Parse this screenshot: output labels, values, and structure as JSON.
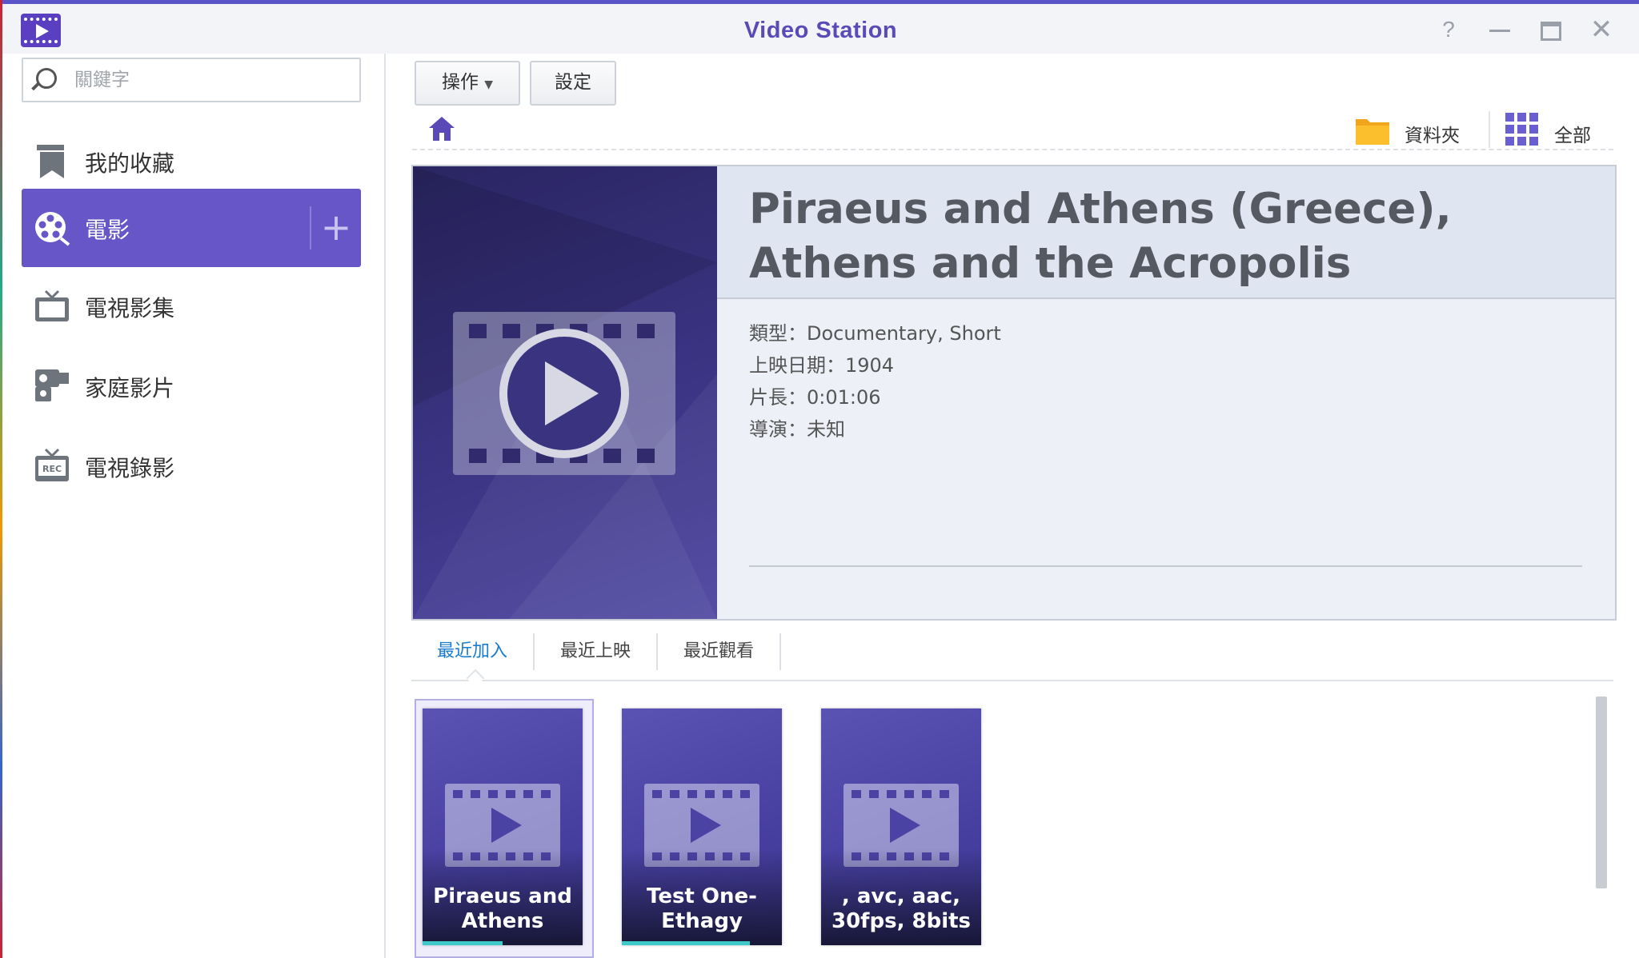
{
  "window": {
    "title": "Video Station",
    "controls": {
      "help": "?",
      "minimize": "minimize",
      "maximize": "maximize",
      "close": "✕"
    }
  },
  "sidebar": {
    "search": {
      "placeholder": "關鍵字",
      "value": ""
    },
    "items": [
      {
        "label": "我的收藏",
        "icon": "bookmark-icon",
        "active": false
      },
      {
        "label": "電影",
        "icon": "film-reel-icon",
        "active": true
      },
      {
        "label": "電視影集",
        "icon": "tv-icon",
        "active": false
      },
      {
        "label": "家庭影片",
        "icon": "camcorder-icon",
        "active": false
      },
      {
        "label": "電視錄影",
        "icon": "tv-rec-icon",
        "active": false
      }
    ],
    "add_label": "+",
    "accent_color": "#6656c7"
  },
  "toolbar": {
    "action_label": "操作",
    "settings_label": "設定",
    "folder_label": "資料夾",
    "all_label": "全部"
  },
  "hero": {
    "title": "Piraeus and Athens (Greece), Athens and the Acropolis",
    "meta": {
      "genre": "類型：Documentary, Short",
      "release": "上映日期：1904",
      "duration": "片長：0:01:06",
      "director": "導演：未知"
    }
  },
  "tabs": [
    {
      "label": "最近加入",
      "active": true
    },
    {
      "label": "最近上映",
      "active": false
    },
    {
      "label": "最近觀看",
      "active": false
    }
  ],
  "cards": [
    {
      "title": "Piraeus and Athens",
      "progress": 0.5,
      "selected": true
    },
    {
      "title": "Test One-Ethagy",
      "progress": 0.8,
      "selected": false
    },
    {
      "title": ", avc, aac, 30fps, 8bits",
      "progress": 0,
      "selected": false
    }
  ],
  "colors": {
    "accent": "#6656c7",
    "title": "#5a4ab8",
    "tab_active": "#1a7ccf",
    "progress": "#3fc9c8"
  }
}
